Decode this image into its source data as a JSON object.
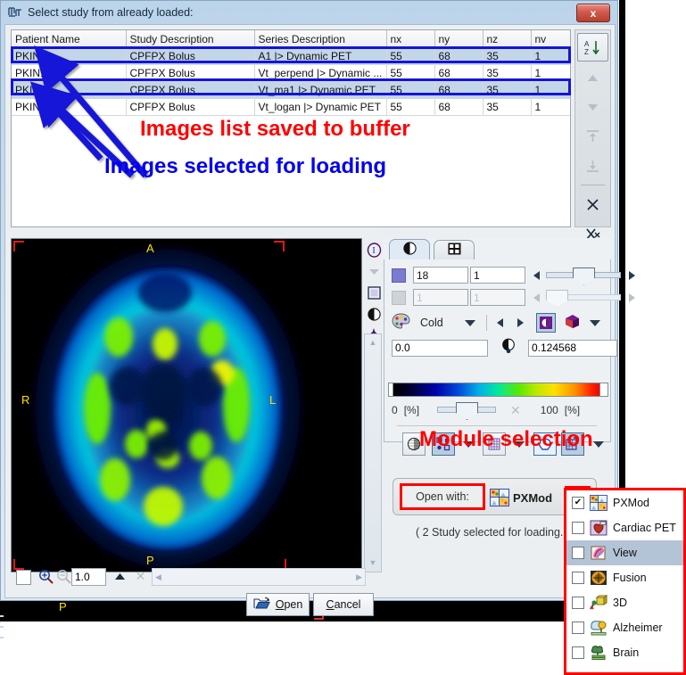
{
  "window": {
    "title": "Select study from already loaded:",
    "title_icon": "pmod-logo-icon",
    "close_label": "x"
  },
  "table": {
    "columns": [
      "Patient Name",
      "Study Description",
      "Series Description",
      "nx",
      "ny",
      "nz",
      "nv"
    ],
    "rows": [
      {
        "patient": "PKIN1",
        "study": "CPFPX Bolus",
        "series": "A1 |> Dynamic PET",
        "nx": "55",
        "ny": "68",
        "nz": "35",
        "nv": "1",
        "selected": true
      },
      {
        "patient": "PKIN1",
        "study": "CPFPX Bolus",
        "series": "Vt_perpend |> Dynamic ...",
        "nx": "55",
        "ny": "68",
        "nz": "35",
        "nv": "1",
        "selected": false
      },
      {
        "patient": "PKIN1",
        "study": "CPFPX Bolus",
        "series": "Vt_ma1 |> Dynamic PET",
        "nx": "55",
        "ny": "68",
        "nz": "35",
        "nv": "1",
        "selected": true
      },
      {
        "patient": "PKIN1",
        "study": "CPFPX Bolus",
        "series": "Vt_logan |> Dynamic PET",
        "nx": "55",
        "ny": "68",
        "nz": "35",
        "nv": "1",
        "selected": false
      }
    ]
  },
  "table_tools": {
    "sort_icon": "sort-az-icon",
    "up_icon": "move-up-icon",
    "down_icon": "move-down-icon",
    "top_icon": "move-to-top-icon",
    "bottom_icon": "move-to-bottom-icon",
    "remove_icon": "remove-icon",
    "remove_all_icon": "remove-all-icon"
  },
  "annotations": {
    "red_top": "Images list saved to buffer",
    "blue": "Images selected for loading",
    "red_module": "Module selection"
  },
  "viewer": {
    "orientation": {
      "anterior": "A",
      "posterior": "P",
      "right": "R",
      "left": "L"
    },
    "rail_icons": [
      "info-icon",
      "chevron-down-icon",
      "layout-square-icon",
      "contrast-icon",
      "crosshair-icon"
    ],
    "scroll_up_icon": "scroll-up-icon",
    "scroll_down_icon": "scroll-down-icon"
  },
  "controls": {
    "tabs": [
      {
        "name": "contrast-tab",
        "icon": "contrast-circle-icon",
        "active": true
      },
      {
        "name": "layout-tab",
        "icon": "grid-four-icon",
        "active": false
      }
    ],
    "slice_row": {
      "value": "18",
      "step": "1",
      "enabled": true
    },
    "frame_row": {
      "value": "1",
      "step": "1",
      "enabled": false
    },
    "colortable": {
      "label": "Cold",
      "palette_icon": "palette-icon"
    },
    "range_min": "0.0",
    "range_max": "0.124568",
    "threshold_icon": "contrast-drop-icon",
    "scale_left": "0",
    "scale_left_unit": "[%]",
    "scale_right": "100",
    "scale_right_unit": "[%]",
    "clear_icon": "clear-x-icon",
    "toolbuttons": [
      {
        "name": "iso-contour-icon",
        "state": "off"
      },
      {
        "name": "markers-icon",
        "state": "on"
      },
      {
        "name": "grid-overlay-icon",
        "state": "off"
      },
      {
        "name": "vois-circle-icon",
        "state": "sel"
      },
      {
        "name": "annotate-icon",
        "state": "on"
      }
    ]
  },
  "module": {
    "open_with_label": "Open with:",
    "selected": "PXMod",
    "selected_icon": "pxmod-icon",
    "caret_icon": "chevron-down-icon",
    "note": "( 2 Study selected for loading."
  },
  "menu": {
    "items": [
      {
        "label": "PXMod",
        "icon": "pxmod-icon",
        "checked": true,
        "highlighted": false
      },
      {
        "label": "Cardiac PET",
        "icon": "heart-icon",
        "checked": false,
        "highlighted": false
      },
      {
        "label": "View",
        "icon": "view-icon",
        "checked": false,
        "highlighted": true
      },
      {
        "label": "Fusion",
        "icon": "fusion-icon",
        "checked": false,
        "highlighted": false
      },
      {
        "label": "3D",
        "icon": "cube-3d-icon",
        "checked": false,
        "highlighted": false
      },
      {
        "label": "Alzheimer",
        "icon": "brain-tree-icon",
        "checked": false,
        "highlighted": false
      },
      {
        "label": "Brain",
        "icon": "brain-icon",
        "checked": false,
        "highlighted": false
      }
    ]
  },
  "bottom": {
    "zoom_checkbox_checked": false,
    "zoom_in_icon": "zoom-in-icon",
    "zoom_out_icon": "zoom-out-icon",
    "zoom_value": "1.0",
    "zoom_up_icon": "triangle-up-icon",
    "zoom_clear_icon": "clear-x-icon",
    "open_label": "Open",
    "open_icon": "open-folder-icon",
    "cancel_label": "Cancel"
  },
  "background": {
    "orientation_marker": "P"
  },
  "colors": {
    "selection_outline": "#1414d8",
    "annotation_red": "#ff0000",
    "annotation_blue": "#0000ee",
    "row_selected": "#c3d6e8",
    "menu_highlight": "#b3c4d6",
    "orientation_marker": "#ffe000",
    "corner_mark": "#e01818"
  }
}
